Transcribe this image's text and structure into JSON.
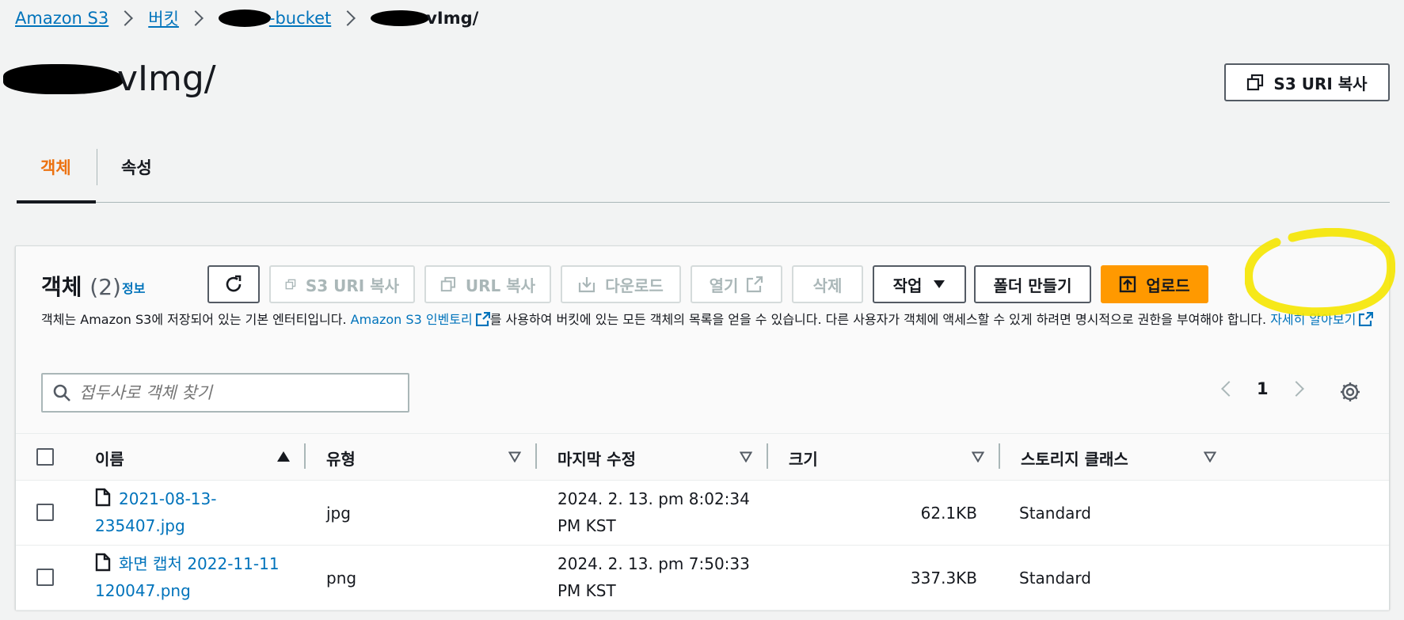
{
  "breadcrumb": {
    "items": [
      {
        "label": "Amazon S3"
      },
      {
        "label": "버킷"
      },
      {
        "label": "-bucket"
      },
      {
        "label": "vImg/"
      }
    ]
  },
  "page": {
    "title": "vImg/",
    "copy_uri_label": "S3 URI 복사"
  },
  "tabs": [
    {
      "label": "객체",
      "active": true
    },
    {
      "label": "속성",
      "active": false
    }
  ],
  "objects_panel": {
    "title": "객체",
    "count": "(2)",
    "info_link": "정보",
    "toolbar": {
      "copy_uri": "S3 URI 복사",
      "copy_url": "URL 복사",
      "download": "다운로드",
      "open": "열기",
      "delete": "삭제",
      "actions": "작업",
      "create_folder": "폴더 만들기",
      "upload": "업로드"
    },
    "description": {
      "part1": "객체는 Amazon S3에 저장되어 있는 기본 엔터티입니다. ",
      "inventory_link": "Amazon S3 인벤토리",
      "part2": "를 사용하여 버킷에 있는 모든 객체의 목록을 얻을 수 있습니다. 다른 사용자가 객체에 액세스할 수 있게 하려면 명시적으로 권한을 부여해야 합니다. ",
      "learn_more_link": "자세히 알아보기"
    },
    "search": {
      "placeholder": "접두사로 객체 찾기",
      "value": ""
    },
    "pagination": {
      "current_page": "1"
    },
    "columns": [
      "이름",
      "유형",
      "마지막 수정",
      "크기",
      "스토리지 클래스"
    ],
    "rows": [
      {
        "name_line1": "2021-08-13-",
        "name_line2": "235407.jpg",
        "type": "jpg",
        "modified_line1": "2024. 2. 13. pm 8:02:34",
        "modified_line2": "PM KST",
        "size": "62.1KB",
        "storage_class": "Standard"
      },
      {
        "name_line1": "화면 캡처 2022-11-11",
        "name_line2": "120047.png",
        "type": "png",
        "modified_line1": "2024. 2. 13. pm 7:50:33",
        "modified_line2": "PM KST",
        "size": "337.3KB",
        "storage_class": "Standard"
      }
    ]
  },
  "colors": {
    "link": "#0073bb",
    "active_tab": "#ec7211",
    "primary_button": "#ff9900",
    "annotation_highlight": "#f5e600"
  }
}
